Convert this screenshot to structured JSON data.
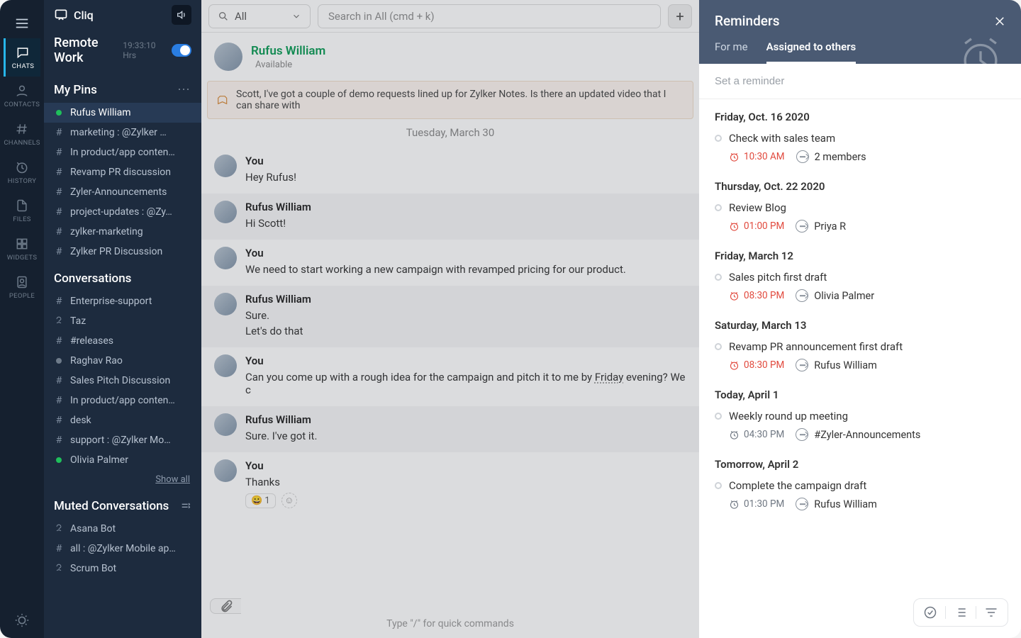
{
  "brand": "Cliq",
  "rail": [
    {
      "label": "CHATS"
    },
    {
      "label": "CONTACTS"
    },
    {
      "label": "CHANNELS"
    },
    {
      "label": "HISTORY"
    },
    {
      "label": "FILES"
    },
    {
      "label": "WIDGETS"
    },
    {
      "label": "PEOPLE"
    }
  ],
  "remote": {
    "title": "Remote Work",
    "time": "19:33:10 Hrs"
  },
  "pins": {
    "label": "My Pins",
    "items": [
      {
        "kind": "presence",
        "status": "online",
        "label": "Rufus William",
        "active": true
      },
      {
        "kind": "hash",
        "label": "marketing : @Zylker …"
      },
      {
        "kind": "hash",
        "label": "In product/app conten…"
      },
      {
        "kind": "hash",
        "label": "Revamp PR discussion"
      },
      {
        "kind": "hash",
        "label": "Zyler-Announcements"
      },
      {
        "kind": "hash",
        "label": "project-updates : @Zy…"
      },
      {
        "kind": "hash",
        "label": "zylker-marketing"
      },
      {
        "kind": "hash",
        "label": "Zylker PR Discussion"
      }
    ]
  },
  "conversations": {
    "label": "Conversations",
    "items": [
      {
        "kind": "hash",
        "label": "Enterprise-support"
      },
      {
        "kind": "bot",
        "label": "Taz"
      },
      {
        "kind": "hash",
        "label": "#releases"
      },
      {
        "kind": "presence",
        "status": "off",
        "label": "Raghav Rao"
      },
      {
        "kind": "hash",
        "label": "Sales Pitch Discussion"
      },
      {
        "kind": "hash",
        "label": "In product/app conten…"
      },
      {
        "kind": "hash",
        "label": "desk"
      },
      {
        "kind": "hash",
        "label": "support : @Zylker Mo…"
      },
      {
        "kind": "presence",
        "status": "online",
        "label": "Olivia Palmer"
      }
    ],
    "show_all": "Show all"
  },
  "muted": {
    "label": "Muted Conversations",
    "items": [
      {
        "kind": "bot",
        "label": "Asana Bot"
      },
      {
        "kind": "hash",
        "label": "all : @Zylker Mobile ap…"
      },
      {
        "kind": "bot",
        "label": "Scrum Bot"
      }
    ]
  },
  "search": {
    "filter": "All",
    "placeholder": "Search in All (cmd + k)"
  },
  "chat": {
    "name": "Rufus William",
    "status": "Available",
    "banner": "Scott, I've got a couple of demo requests lined up for Zylker Notes. Is there an updated video that I can share with",
    "date": "Tuesday, March 30",
    "messages": [
      {
        "author": "You",
        "lines": [
          "Hey Rufus!"
        ],
        "alt": false
      },
      {
        "author": "Rufus William",
        "lines": [
          "Hi Scott!"
        ],
        "alt": true
      },
      {
        "author": "You",
        "lines": [
          "We need to start working a new campaign with revamped pricing for our product."
        ],
        "alt": false
      },
      {
        "author": "Rufus William",
        "lines": [
          "Sure.",
          "Let's do that"
        ],
        "alt": true
      },
      {
        "author": "You",
        "lines": [
          "Can you come up with a rough idea for the campaign and pitch it to me by  <u>Friday</u>  evening? We c"
        ],
        "alt": false
      },
      {
        "author": "Rufus William",
        "lines": [
          "Sure. I've got it."
        ],
        "alt": true
      },
      {
        "author": "You",
        "lines": [
          "Thanks"
        ],
        "alt": false,
        "reaction": {
          "emoji": "😀",
          "count": "1"
        }
      }
    ],
    "hint": "Type \"/\" for quick commands"
  },
  "reminders": {
    "title": "Reminders",
    "tabs": {
      "a": "For me",
      "b": "Assigned to others"
    },
    "input_placeholder": "Set a reminder",
    "groups": [
      {
        "date": "Friday, Oct. 16 2020",
        "items": [
          {
            "title": "Check with sales team",
            "time": "10:30 AM",
            "assignee": "2 members",
            "red": true
          }
        ]
      },
      {
        "date": "Thursday, Oct. 22 2020",
        "items": [
          {
            "title": "Review Blog",
            "time": "01:00 PM",
            "assignee": "Priya R",
            "red": true
          }
        ]
      },
      {
        "date": "Friday, March 12",
        "items": [
          {
            "title": "Sales pitch first draft",
            "time": "08:30 PM",
            "assignee": "Olivia Palmer",
            "red": true
          }
        ]
      },
      {
        "date": "Saturday, March 13",
        "items": [
          {
            "title": "Revamp PR announcement first draft",
            "time": "08:30 PM",
            "assignee": "Rufus William",
            "red": true
          }
        ]
      },
      {
        "date": "Today, April 1",
        "items": [
          {
            "title": "Weekly round up meeting",
            "time": "04:30 PM",
            "assignee": "#Zyler-Announcements",
            "red": false
          }
        ]
      },
      {
        "date": "Tomorrow, April 2",
        "items": [
          {
            "title": "Complete the campaign draft",
            "time": "01:30 PM",
            "assignee": "Rufus William",
            "red": false
          }
        ]
      }
    ]
  }
}
